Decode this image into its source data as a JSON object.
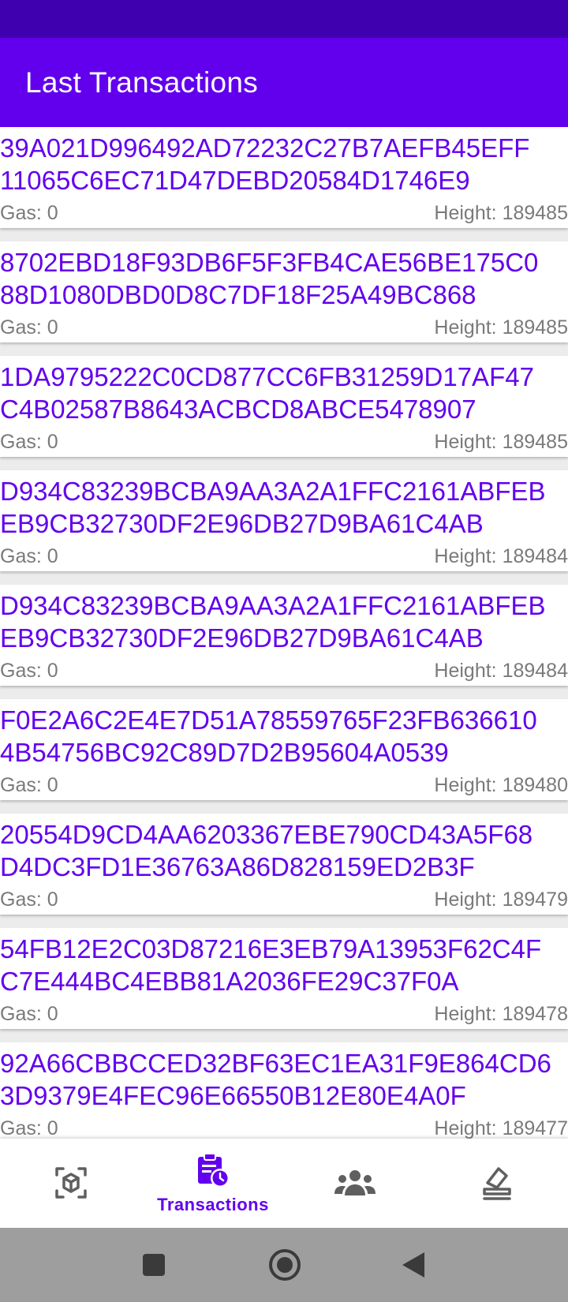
{
  "app_bar": {
    "title": "Last Transactions"
  },
  "transactions": [
    {
      "hash_line1": "39A021D996492AD72232C27B7AEFB45EFF",
      "hash_line2": "11065C6EC71D47DEBD20584D1746E9",
      "gas": "Gas: 0",
      "height": "Height: 189485"
    },
    {
      "hash_line1": "8702EBD18F93DB6F5F3FB4CAE56BE175C0",
      "hash_line2": "88D1080DBD0D8C7DF18F25A49BC868",
      "gas": "Gas: 0",
      "height": "Height: 189485"
    },
    {
      "hash_line1": "1DA9795222C0CD877CC6FB31259D17AF47",
      "hash_line2": "C4B02587B8643ACBCD8ABCE5478907",
      "gas": "Gas: 0",
      "height": "Height: 189485"
    },
    {
      "hash_line1": "D934C83239BCBA9AA3A2A1FFC2161ABFEB",
      "hash_line2": "EB9CB32730DF2E96DB27D9BA61C4AB",
      "gas": "Gas: 0",
      "height": "Height: 189484"
    },
    {
      "hash_line1": "D934C83239BCBA9AA3A2A1FFC2161ABFEB",
      "hash_line2": "EB9CB32730DF2E96DB27D9BA61C4AB",
      "gas": "Gas: 0",
      "height": "Height: 189484"
    },
    {
      "hash_line1": "F0E2A6C2E4E7D51A78559765F23FB636610",
      "hash_line2": "4B54756BC92C89D7D2B95604A0539",
      "gas": "Gas: 0",
      "height": "Height: 189480"
    },
    {
      "hash_line1": "20554D9CD4AA6203367EBE790CD43A5F68",
      "hash_line2": "D4DC3FD1E36763A86D828159ED2B3F",
      "gas": "Gas: 0",
      "height": "Height: 189479"
    },
    {
      "hash_line1": "54FB12E2C03D87216E3EB79A13953F62C4F",
      "hash_line2": "C7E444BC4EBB81A2036FE29C37F0A",
      "gas": "Gas: 0",
      "height": "Height: 189478"
    },
    {
      "hash_line1": "92A66CBBCCED32BF63EC1EA31F9E864CD6",
      "hash_line2": "3D9379E4FEC96E66550B12E80E4A0F",
      "gas": "Gas: 0",
      "height": "Height: 189477"
    }
  ],
  "bottom_nav": {
    "items": [
      {
        "icon": "cube-scan-icon",
        "label": ""
      },
      {
        "icon": "clipboard-clock-icon",
        "label": "Transactions",
        "selected": true
      },
      {
        "icon": "people-group-icon",
        "label": ""
      },
      {
        "icon": "stamp-icon",
        "label": ""
      }
    ],
    "active_color": "#6200ee",
    "inactive_color": "#5f5f5f"
  },
  "colors": {
    "status_bar": "#3f00b0",
    "app_bar": "#6200ee",
    "hash_text": "#6200ee",
    "meta_text": "#7a7a7a"
  },
  "system_nav": {
    "buttons": [
      "recents-icon",
      "home-icon",
      "back-icon"
    ]
  }
}
